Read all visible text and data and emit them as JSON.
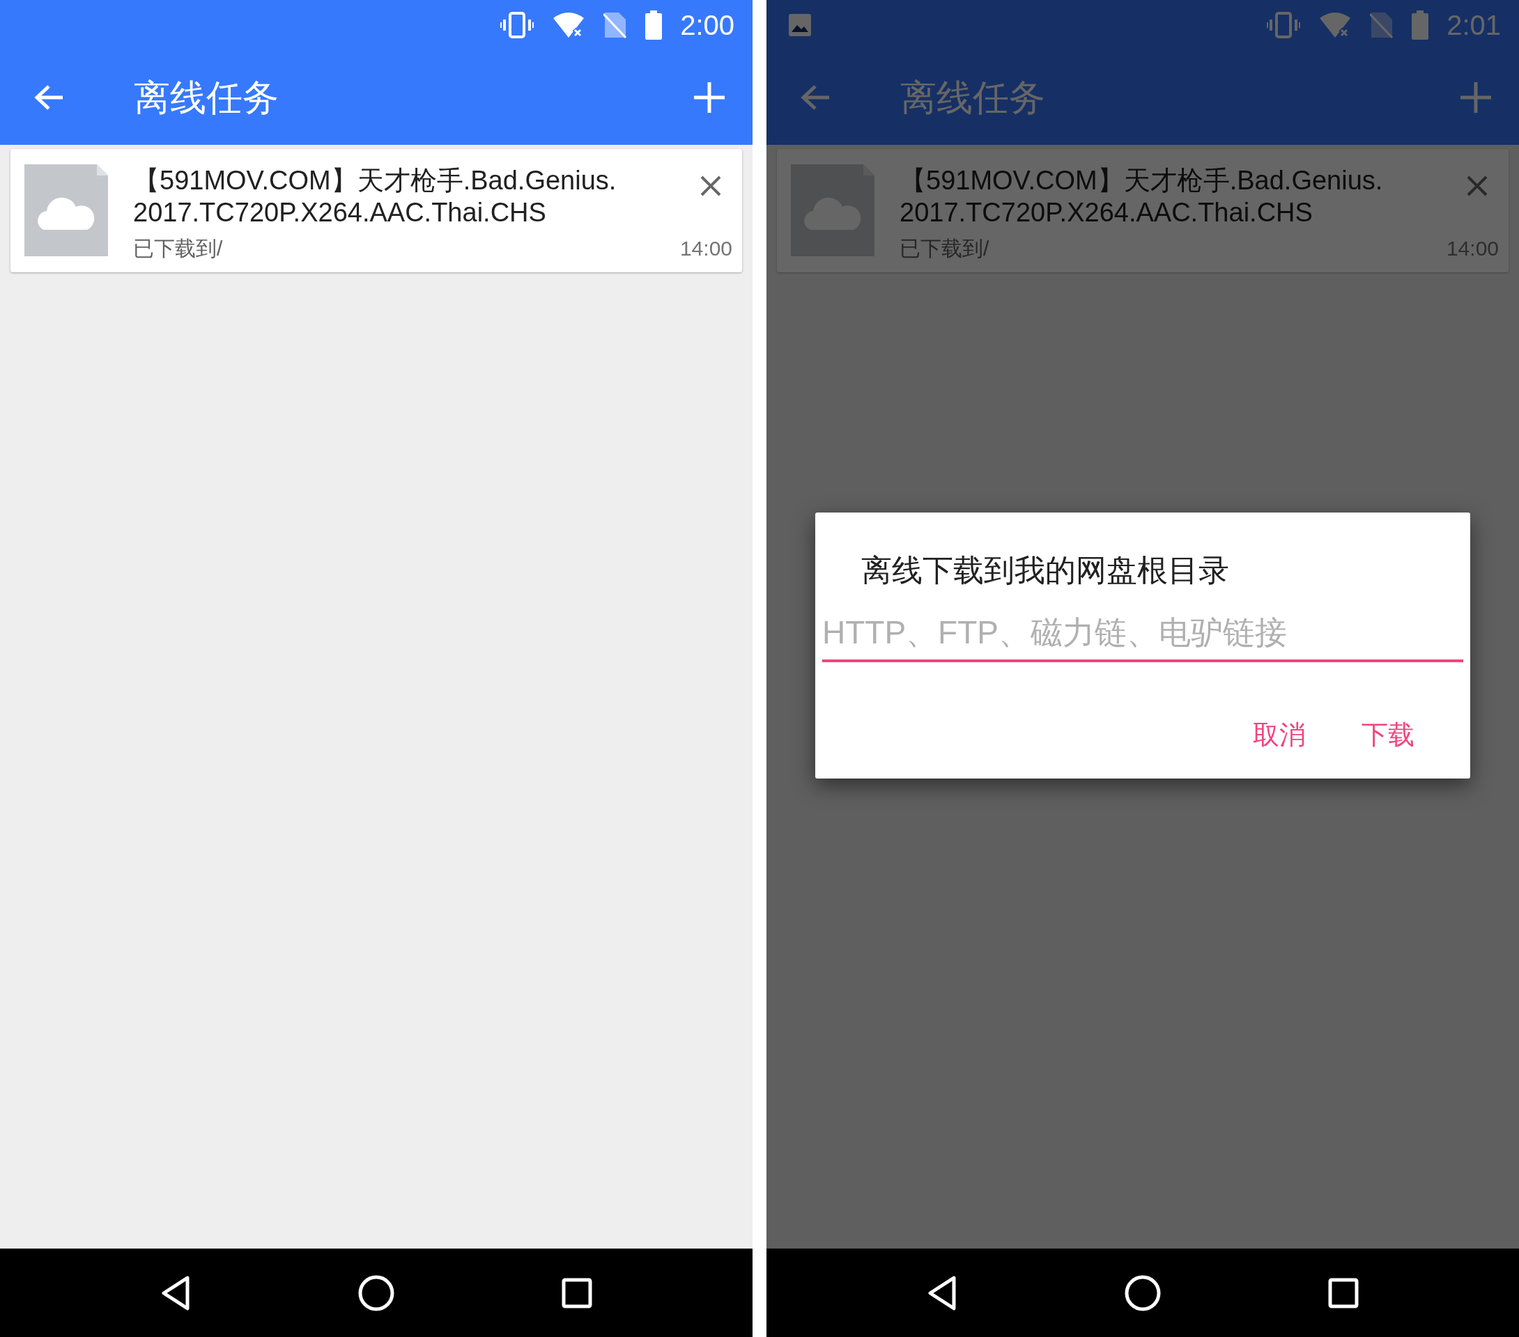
{
  "screens": [
    {
      "status_bar": {
        "time": "2:00",
        "notification_icon": false
      },
      "toolbar": {
        "title": "离线任务"
      },
      "dimmed": false,
      "tasks": [
        {
          "name": "【591MOV.COM】天才枪手.Bad.Genius.2017.TC720P.X264.AAC.Thai.CHS",
          "status": "已下载到/",
          "time": "14:00"
        }
      ]
    },
    {
      "status_bar": {
        "time": "2:01",
        "notification_icon": true
      },
      "toolbar": {
        "title": "离线任务"
      },
      "dimmed": true,
      "tasks": [
        {
          "name": "【591MOV.COM】天才枪手.Bad.Genius.2017.TC720P.X264.AAC.Thai.CHS",
          "status": "已下载到/",
          "time": "14:00"
        }
      ],
      "dialog": {
        "title": "离线下载到我的网盘根目录",
        "input": {
          "placeholder": "HTTP、FTP、磁力链、电驴链接",
          "focused": true
        },
        "buttons": [
          "取消",
          "下载"
        ]
      }
    }
  ]
}
